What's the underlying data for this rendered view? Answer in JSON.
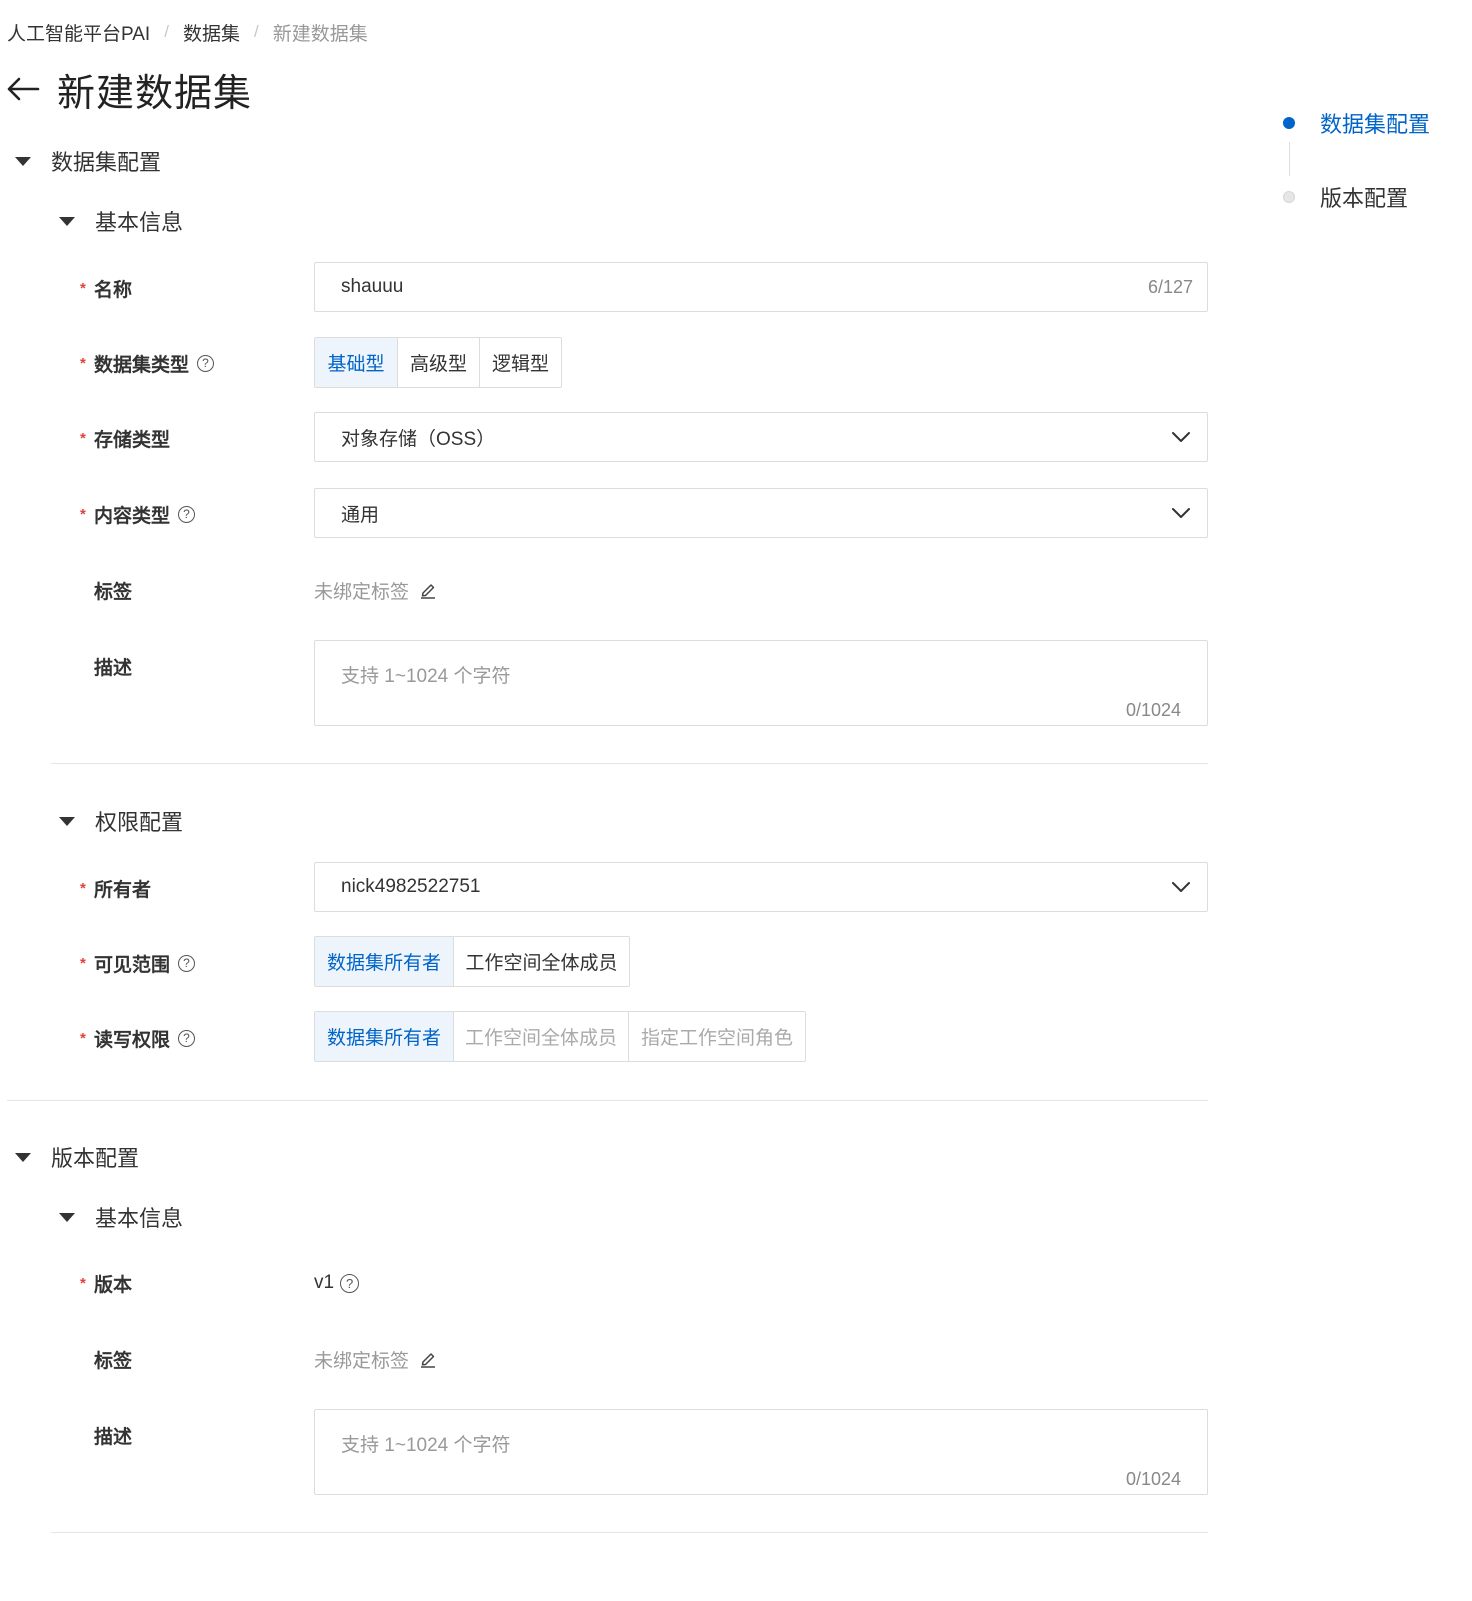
{
  "breadcrumb": {
    "items": [
      "人工智能平台PAI",
      "数据集",
      "新建数据集"
    ],
    "separator": "/"
  },
  "page": {
    "title": "新建数据集"
  },
  "anchor_nav": {
    "items": [
      {
        "label": "数据集配置",
        "active": true
      },
      {
        "label": "版本配置",
        "active": false
      }
    ],
    "active_color": "#0064c8"
  },
  "dataset_config": {
    "title": "数据集配置",
    "basic_info": {
      "title": "基本信息",
      "name": {
        "label": "名称",
        "value": "shauuu",
        "count": "6/127"
      },
      "dataset_type": {
        "label": "数据集类型",
        "options": [
          "基础型",
          "高级型",
          "逻辑型"
        ],
        "selected": "基础型"
      },
      "storage_type": {
        "label": "存储类型",
        "value": "对象存储（OSS）"
      },
      "content_type": {
        "label": "内容类型",
        "value": "通用"
      },
      "tags": {
        "label": "标签",
        "value": "未绑定标签"
      },
      "description": {
        "label": "描述",
        "placeholder": "支持 1~1024 个字符",
        "count": "0/1024"
      }
    },
    "permissions": {
      "title": "权限配置",
      "owner": {
        "label": "所有者",
        "value": "nick4982522751"
      },
      "visibility": {
        "label": "可见范围",
        "options": [
          "数据集所有者",
          "工作空间全体成员"
        ],
        "selected": "数据集所有者"
      },
      "rw_permission": {
        "label": "读写权限",
        "options": [
          "数据集所有者",
          "工作空间全体成员",
          "指定工作空间角色"
        ],
        "selected": "数据集所有者",
        "disabled": [
          "工作空间全体成员",
          "指定工作空间角色"
        ]
      }
    }
  },
  "version_config": {
    "title": "版本配置",
    "basic_info": {
      "title": "基本信息",
      "version": {
        "label": "版本",
        "value": "v1"
      },
      "tags": {
        "label": "标签",
        "value": "未绑定标签"
      },
      "description": {
        "label": "描述",
        "placeholder": "支持 1~1024 个字符",
        "count": "0/1024"
      }
    }
  },
  "colors": {
    "accent": "#0064c8",
    "required": "#e0413a",
    "selected_bg": "#eef4fb"
  }
}
